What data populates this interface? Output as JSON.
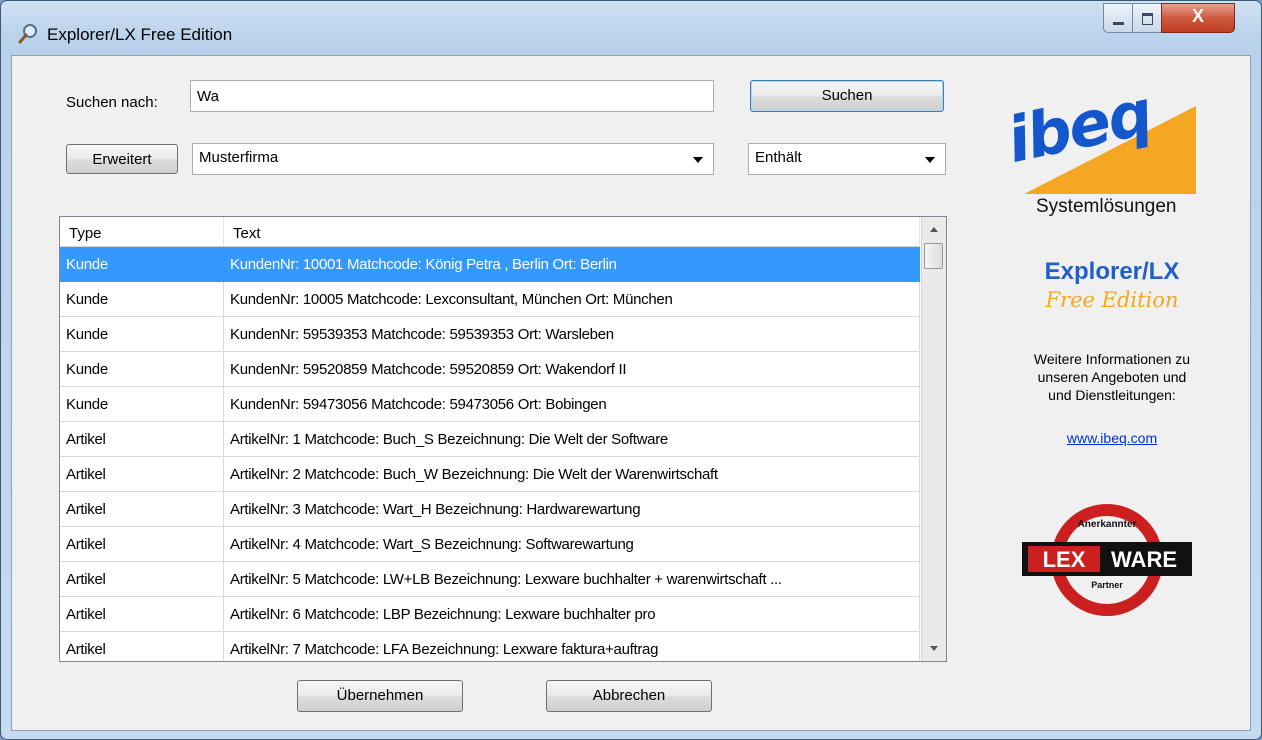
{
  "window": {
    "title": "Explorer/LX Free Edition",
    "close_glyph": "X"
  },
  "search": {
    "label": "Suchen nach:",
    "value": "Wa",
    "button": "Suchen"
  },
  "filter": {
    "button": "Erweitert",
    "company": "Musterfirma",
    "mode": "Enthält"
  },
  "grid": {
    "headers": [
      "Type",
      "Text"
    ],
    "rows": [
      {
        "type": "Kunde",
        "text": "KundenNr: 10001  Matchcode: König Petra , Berlin  Ort: Berlin"
      },
      {
        "type": "Kunde",
        "text": "KundenNr: 10005  Matchcode: Lexconsultant, München  Ort: München"
      },
      {
        "type": "Kunde",
        "text": "KundenNr: 59539353  Matchcode: 59539353  Ort: Warsleben"
      },
      {
        "type": "Kunde",
        "text": "KundenNr: 59520859  Matchcode: 59520859  Ort: Wakendorf II"
      },
      {
        "type": "Kunde",
        "text": "KundenNr: 59473056  Matchcode: 59473056  Ort: Bobingen"
      },
      {
        "type": "Artikel",
        "text": "ArtikelNr: 1  Matchcode: Buch_S  Bezeichnung: Die Welt der Software"
      },
      {
        "type": "Artikel",
        "text": "ArtikelNr: 2  Matchcode: Buch_W  Bezeichnung: Die Welt der Warenwirtschaft"
      },
      {
        "type": "Artikel",
        "text": "ArtikelNr: 3  Matchcode: Wart_H  Bezeichnung: Hardwarewartung"
      },
      {
        "type": "Artikel",
        "text": "ArtikelNr: 4  Matchcode: Wart_S  Bezeichnung: Softwarewartung"
      },
      {
        "type": "Artikel",
        "text": "ArtikelNr: 5  Matchcode: LW+LB  Bezeichnung: Lexware buchhalter + warenwirtschaft ..."
      },
      {
        "type": "Artikel",
        "text": "ArtikelNr: 6  Matchcode: LBP  Bezeichnung: Lexware buchhalter pro"
      },
      {
        "type": "Artikel",
        "text": "ArtikelNr: 7  Matchcode: LFA  Bezeichnung: Lexware faktura+auftrag"
      }
    ],
    "selected_index": 0
  },
  "actions": {
    "accept": "Übernehmen",
    "cancel": "Abbrechen"
  },
  "brand": {
    "logo": "ibeq",
    "logo_sub": "Systemlösungen",
    "product": "Explorer/LX",
    "edition": "Free Edition",
    "info_lines": [
      "Weitere Informationen zu",
      "unseren Angeboten und",
      "und Dienstleitungen:"
    ],
    "link": "www.ibeq.com",
    "badge_top": "Anerkannter",
    "badge_lex": "LEX",
    "badge_ware": "WARE",
    "badge_bottom": "Partner",
    "colors": {
      "blue": "#1457cc",
      "orange": "#f5a623",
      "badge_red": "#cc1f1f",
      "selection": "#3399ff"
    }
  }
}
